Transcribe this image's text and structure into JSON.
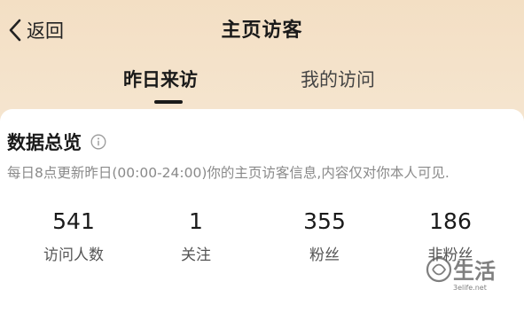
{
  "header": {
    "back_label": "返回",
    "title": "主页访客"
  },
  "tabs": [
    {
      "label": "昨日来访",
      "active": true
    },
    {
      "label": "我的访问",
      "active": false
    }
  ],
  "overview": {
    "title": "数据总览",
    "description": "每日8点更新昨日(00:00-24:00)你的主页访客信息,内容仅对你本人可见.",
    "stats": [
      {
        "value": "541",
        "label": "访问人数"
      },
      {
        "value": "1",
        "label": "关注"
      },
      {
        "value": "355",
        "label": "粉丝"
      },
      {
        "value": "186",
        "label": "非粉丝"
      }
    ]
  },
  "watermark": {
    "text": "生活",
    "url_text": "3elife.net"
  },
  "icons": {
    "back": "chevron-left-icon",
    "info": "info-circle-icon"
  },
  "colors": {
    "header_bg": "#f3dfc4",
    "card_bg": "#ffffff",
    "text_primary": "#1a1a1a",
    "text_secondary": "#8a8a8a"
  }
}
